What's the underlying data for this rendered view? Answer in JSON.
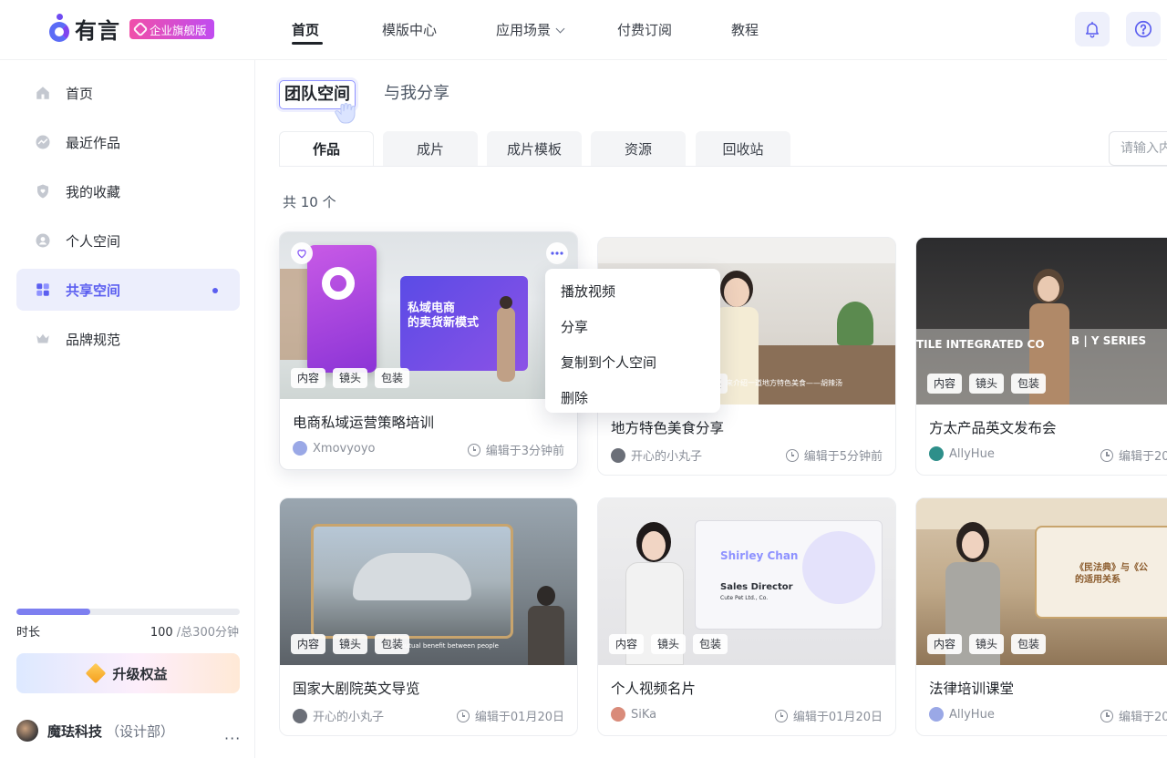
{
  "app": {
    "logo_text": "有言",
    "edition_badge": "企业旗舰版"
  },
  "nav": {
    "items": [
      "首页",
      "模版中心",
      "应用场景",
      "付费订阅",
      "教程"
    ],
    "active": "首页"
  },
  "sidebar": {
    "items": [
      "首页",
      "最近作品",
      "我的收藏",
      "个人空间",
      "共享空间",
      "品牌规范"
    ],
    "active": "共享空间",
    "quota": {
      "label": "时长",
      "used": "100",
      "total": " /总300分钟",
      "fraction": 0.33
    },
    "upgrade_label": "升级权益",
    "user": {
      "org": "魔珐科技",
      "dept": "（设计部）",
      "more": "···"
    }
  },
  "main": {
    "space_tabs": [
      "团队空间",
      "与我分享"
    ],
    "active_space_tab": "团队空间",
    "subtabs": [
      "作品",
      "成片",
      "成片模板",
      "资源",
      "回收站"
    ],
    "active_subtab": "作品",
    "search_placeholder": "请输入内",
    "count_text": "共 10 个",
    "cards": [
      {
        "title": "电商私域运营策略培训",
        "author": "Xmovyoyo",
        "edited": "编辑于3分钟前",
        "tags": [
          "内容",
          "镜头",
          "包装"
        ],
        "thumb_text": [
          "私域电商",
          "的卖货新模式"
        ]
      },
      {
        "title": "地方特色美食分享",
        "author": "开心的小丸子",
        "edited": "编辑于5分钟前",
        "tags": [
          "内容",
          "镜头",
          "包装"
        ],
        "thumb_text": [
          "来介绍一道地方特色美食——胡辣汤"
        ]
      },
      {
        "title": "方太产品英文发布会",
        "author": "AllyHue",
        "edited": "编辑于20",
        "tags": [
          "内容",
          "镜头",
          "包装"
        ],
        "thumb_text": [
          "TILE INTEGRATED CO",
          "B | Y SERIES"
        ]
      },
      {
        "title": "国家大剧院英文导览",
        "author": "开心的小丸子",
        "edited": "编辑于01月20日",
        "tags": [
          "内容",
          "镜头",
          "包装"
        ],
        "thumb_text": [
          "mutual benefit between people"
        ]
      },
      {
        "title": "个人视频名片",
        "author": "SiKa",
        "edited": "编辑于01月20日",
        "tags": [
          "内容",
          "镜头",
          "包装"
        ],
        "thumb_text": [
          "Shirley Chan",
          "Sales Director",
          "Cute Pet Ltd., Co."
        ]
      },
      {
        "title": "法律培训课堂",
        "author": "AllyHue",
        "edited": "编辑于20",
        "tags": [
          "内容",
          "镜头",
          "包装"
        ],
        "thumb_text": [
          "《民法典》与《公",
          "的适用关系"
        ]
      }
    ]
  },
  "context_menu": {
    "items": [
      "播放视频",
      "分享",
      "复制到个人空间",
      "删除"
    ]
  },
  "colors": {
    "accent": "#5b5ef0",
    "active_bg": "#eceefc",
    "badge_start": "#f04fa9",
    "badge_end": "#c04cf0"
  }
}
